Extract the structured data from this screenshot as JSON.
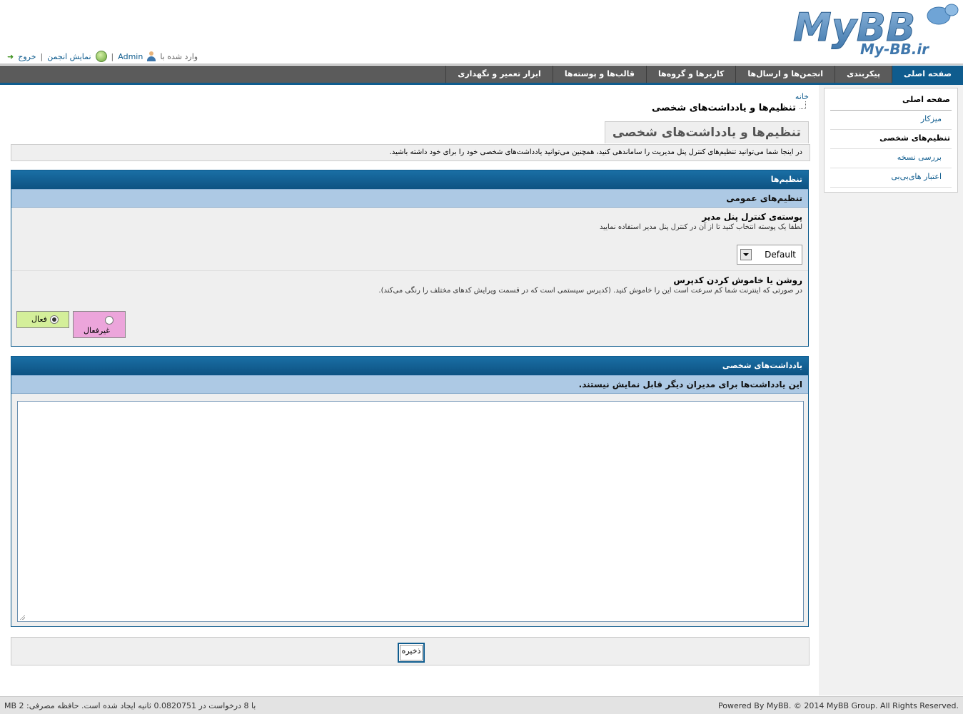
{
  "header": {
    "logo_text": "MyBB",
    "logo_subtext": "My-BB.ir",
    "logged_in_prefix": "وارد شده با",
    "username": "Admin",
    "view_forum": "نمایش انجمن",
    "logout": "خروج"
  },
  "menu": {
    "tabs": [
      {
        "label": "صفحه اصلی",
        "active": true
      },
      {
        "label": "پیکربندی"
      },
      {
        "label": "انجمن‌ها و ارسال‌ها"
      },
      {
        "label": "کاربرها و گروه‌ها"
      },
      {
        "label": "قالب‌ها و پوسته‌ها"
      },
      {
        "label": "ابزار تعمیر و نگهداری"
      }
    ]
  },
  "sidebar": {
    "title": "صفحه اصلی",
    "items": [
      {
        "label": "میزکار"
      },
      {
        "label": "تنظیم‌های شخصی",
        "current": true
      },
      {
        "label": "بررسی نسخه"
      },
      {
        "label": "اعتبار های‌بی‌بی"
      }
    ]
  },
  "breadcrumb": {
    "home": "خانه",
    "current": "تنظیم‌ها و یادداشت‌های شخصی"
  },
  "page": {
    "title": "تنظیم‌ها و یادداشت‌های شخصی",
    "intro": "در اینجا شما می‌توانید تنظیم‌های کنترل پنل مدیریت را ساماندهی کنید، همچنین می‌توانید یادداشت‌های شخصی خود را برای خود داشته باشید."
  },
  "settings": {
    "heading": "تنظیم‌ها",
    "subheading": "تنظیم‌های عمومی",
    "theme": {
      "label": "پوسته‌ی کنترل پنل مدیر",
      "desc": "لطفا یک پوسته انتخاب کنید تا از آن در کنترل پنل مدیر استفاده نمایید",
      "value": "Default"
    },
    "codepress": {
      "label": "روشن یا خاموش کردن کدپرس",
      "desc": "در صورتی که اینترنت شما کم سرعت است این را خاموش کنید. (کدپرس سیستمی است که در قسمت ویرایش کدهای مختلف را رنگی می‌کند).",
      "off_label": "غیرفعال",
      "on_label": "فعال",
      "selected": "on"
    }
  },
  "notes": {
    "heading": "یادداشت‌های شخصی",
    "subheading": "این یادداشت‌ها برای مدیران دیگر قابل نمایش نیستند.",
    "content": ""
  },
  "save_label": "ذخیره",
  "footer": {
    "left": "با 8 درخواست در 0.0820751 ثانیه ایجاد شده است. حافظه مصرفی: 2 MB",
    "right": "Powered By MyBB. © 2014 MyBB Group. All Rights Reserved."
  },
  "colors": {
    "accent": "#0f5c8e",
    "menu_bg": "#5b5b5b",
    "subheader_bg": "#adc9e4",
    "radio_off_bg": "#eca5db",
    "radio_on_bg": "#d4ef9a"
  }
}
